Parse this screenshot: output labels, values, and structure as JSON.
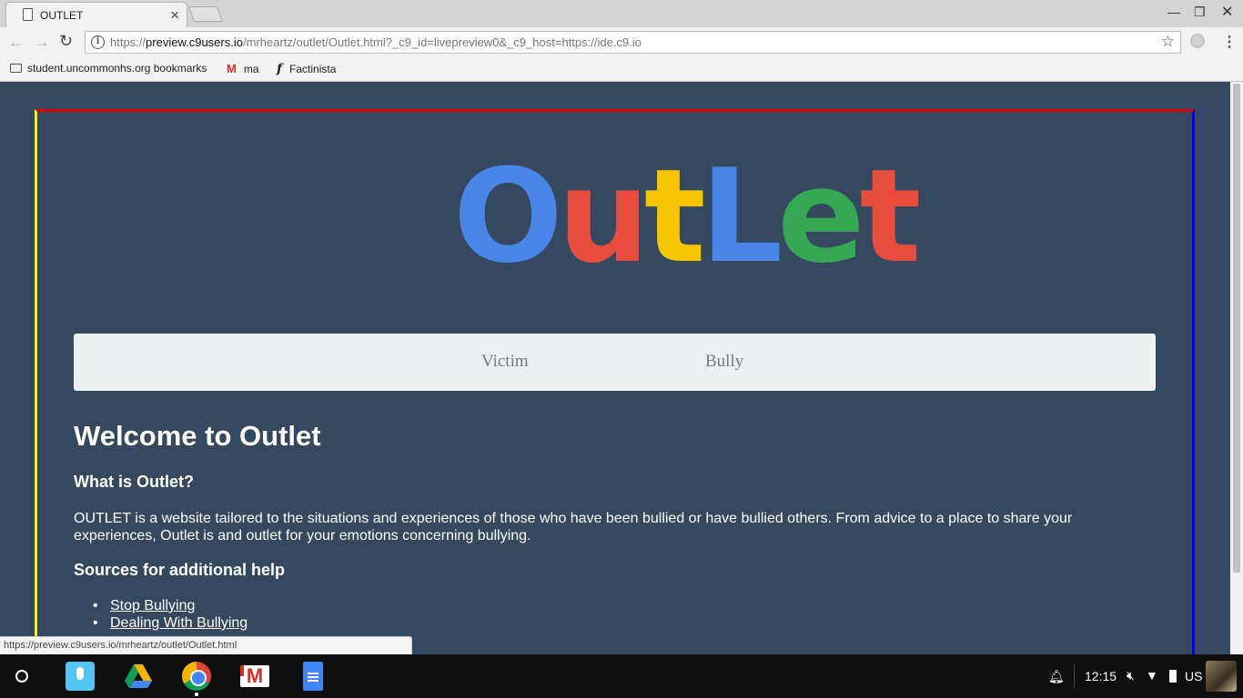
{
  "browser": {
    "tab_title": "OUTLET",
    "url_prefix": "https://",
    "url_host": "preview.c9users.io",
    "url_path": "/mrheartz/outlet/Outlet.html?_c9_id=livepreview0&_c9_host=https://ide.c9.io",
    "bookmarks": [
      {
        "label": "student.uncommonhs.org bookmarks",
        "icon": "folder-icon"
      },
      {
        "label": "ma",
        "icon": "gmail-icon"
      },
      {
        "label": "Factinista",
        "icon": "factinista-icon"
      }
    ],
    "status_url": "https://preview.c9users.io/mrheartz/outlet/Outlet.html"
  },
  "page": {
    "logo_letters": [
      {
        "char": "O",
        "color": "#4a86e8"
      },
      {
        "char": "u",
        "color": "#e84c3d"
      },
      {
        "char": "t",
        "color": "#f7c600"
      },
      {
        "char": "L",
        "color": "#4a86e8"
      },
      {
        "char": "e",
        "color": "#34a853"
      },
      {
        "char": "t",
        "color": "#e84c3d"
      }
    ],
    "nav": {
      "victim": "Victim",
      "bully": "Bully"
    },
    "heading": "Welcome to Outlet",
    "subheading": "What is Outlet?",
    "paragraph": "OUTLET is a website tailored to the situations and experiences of those who have been bullied or have bullied others. From advice to a place to share your experiences, Outlet is and outlet for your emotions concerning bullying.",
    "sources_heading": "Sources for additional help",
    "sources": [
      "Stop Bullying",
      "Dealing With Bullying"
    ],
    "frame_colors": {
      "top": "#e00000",
      "left": "#ffee00",
      "right": "#0000ff"
    }
  },
  "shelf": {
    "apps": [
      "voice-search-icon",
      "drive-icon",
      "chrome-icon",
      "gmail-icon",
      "docs-icon"
    ],
    "time": "12:15",
    "language": "US"
  }
}
